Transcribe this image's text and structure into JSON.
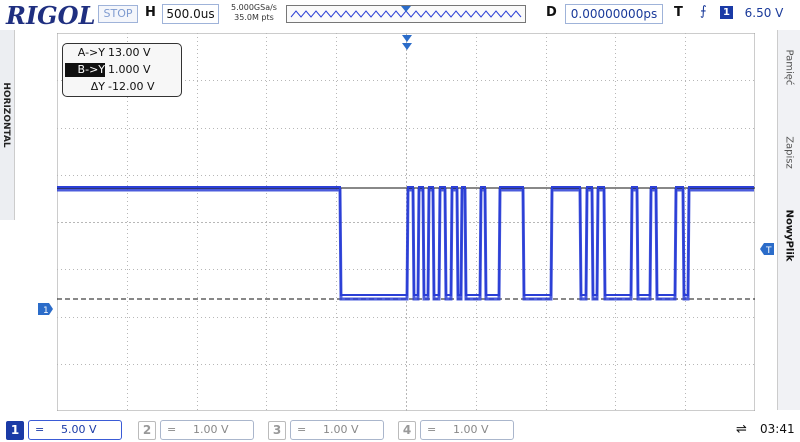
{
  "header": {
    "brand": "RIGOL",
    "run_state": "STOP",
    "h_label": "H",
    "timebase": "500.0us",
    "sample_rate": "5.000GSa/s",
    "memory_depth": "35.0M pts",
    "delay_label": "D",
    "delay": "0.00000000ps",
    "trigger_label": "T",
    "trigger_channel": "1",
    "trigger_level": "6.50 V"
  },
  "left_tab": "HORIZONTAL",
  "right_menu": [
    {
      "label": "Pamięć",
      "active": false
    },
    {
      "label": "Zapisz",
      "active": false
    },
    {
      "label": "NowyPlik",
      "active": true
    }
  ],
  "cursors": {
    "a_label": "A->Y",
    "a_value": "13.00 V",
    "b_label": "B->Y",
    "b_value": "1.000 V",
    "delta_label": "ΔY",
    "delta_value": "-12.00 V"
  },
  "channels": [
    {
      "num": "1",
      "coupling": "=",
      "scale": "5.00 V",
      "active": true
    },
    {
      "num": "2",
      "coupling": "=",
      "scale": "1.00 V",
      "active": false
    },
    {
      "num": "3",
      "coupling": "=",
      "scale": "1.00 V",
      "active": false
    },
    {
      "num": "4",
      "coupling": "=",
      "scale": "1.00 V",
      "active": false
    }
  ],
  "status": {
    "usb_icon": "usb-icon",
    "time": "03:41"
  },
  "colors": {
    "trace": "#2b3fd6",
    "grid": "#b7b7b7",
    "accent": "#1a3aa6"
  },
  "markers": {
    "channel_ground": "1"
  }
}
